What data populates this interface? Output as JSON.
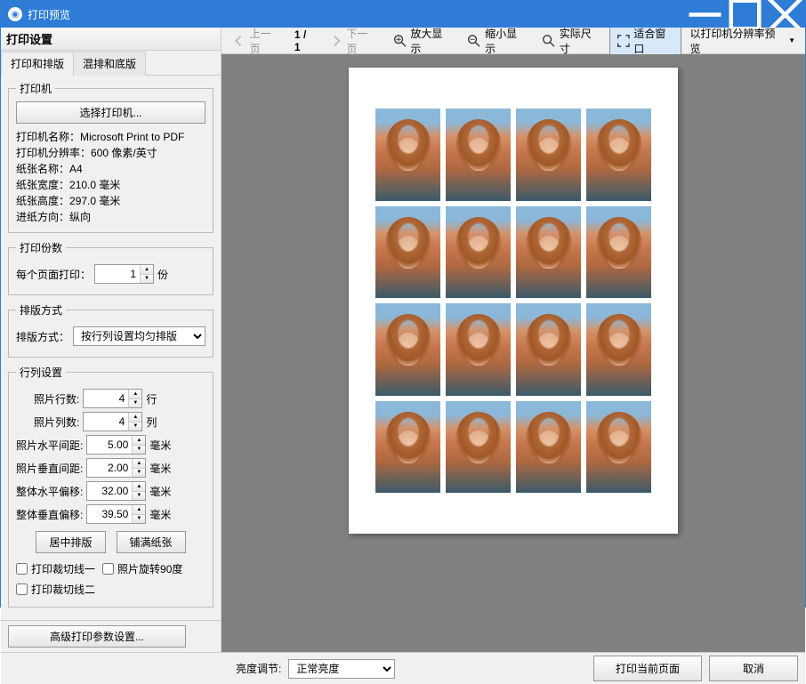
{
  "window": {
    "title": "打印预览"
  },
  "sidebar": {
    "header": "打印设置",
    "tabs": [
      "打印和排版",
      "混排和底版"
    ],
    "printer": {
      "legend": "打印机",
      "select_btn": "选择打印机...",
      "name_label": "打印机名称：",
      "name_value": "Microsoft Print to PDF",
      "res_label": "打印机分辨率：",
      "res_value": "600 像素/英寸",
      "paper_label": "纸张名称：",
      "paper_value": "A4",
      "width_label": "纸张宽度：",
      "width_value": "210.0 毫米",
      "height_label": "纸张高度：",
      "height_value": "297.0 毫米",
      "feed_label": "进纸方向：",
      "feed_value": "纵向"
    },
    "copies": {
      "legend": "打印份数",
      "label": "每个页面打印：",
      "value": "1",
      "unit": "份"
    },
    "layout_mode": {
      "legend": "排版方式",
      "label": "排版方式：",
      "value": "按行列设置均匀排版"
    },
    "grid": {
      "legend": "行列设置",
      "rows_label": "照片行数:",
      "rows_value": "4",
      "rows_unit": "行",
      "cols_label": "照片列数:",
      "cols_value": "4",
      "cols_unit": "列",
      "hgap_label": "照片水平间距:",
      "hgap_value": "5.00",
      "hgap_unit": "毫米",
      "vgap_label": "照片垂直间距:",
      "vgap_value": "2.00",
      "vgap_unit": "毫米",
      "hoff_label": "整体水平偏移:",
      "hoff_value": "32.00",
      "hoff_unit": "毫米",
      "voff_label": "整体垂直偏移:",
      "voff_value": "39.50",
      "voff_unit": "毫米",
      "center_btn": "居中排版",
      "fill_btn": "铺满纸张",
      "cut1_label": "打印裁切线一",
      "rotate_label": "照片旋转90度",
      "cut2_label": "打印裁切线二"
    },
    "advanced_btn": "高级打印参数设置..."
  },
  "toolbar": {
    "prev": "上一页",
    "page_current": "1",
    "page_sep": "/",
    "page_total": "1",
    "next": "下一页",
    "zoom_in": "放大显示",
    "zoom_out": "缩小显示",
    "actual": "实际尺寸",
    "fit": "适合窗口",
    "printer_res": "以打印机分辨率预览"
  },
  "footer": {
    "brightness_label": "亮度调节:",
    "brightness_value": "正常亮度",
    "print_btn": "打印当前页面",
    "cancel_btn": "取消"
  }
}
